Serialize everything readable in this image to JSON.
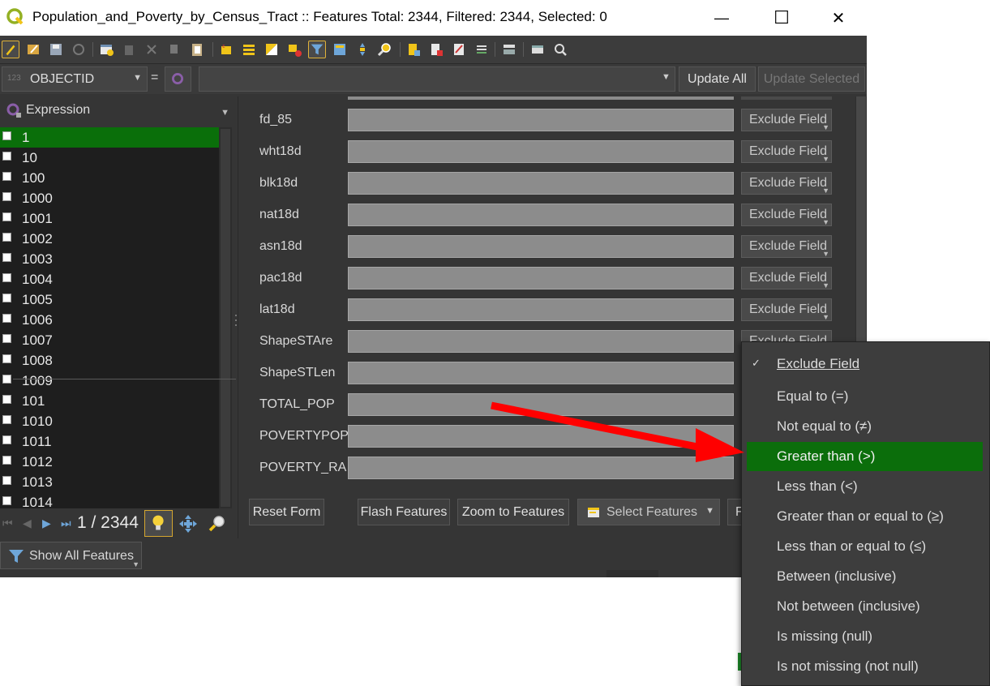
{
  "window": {
    "title": "Population_and_Poverty_by_Census_Tract :: Features Total: 2344, Filtered: 2344, Selected: 0",
    "minimize": "—",
    "maximize": "☐",
    "close": "✕"
  },
  "toolbar": {
    "icons": [
      "toggle-editing-icon",
      "multi-edit-icon",
      "save-edits-icon",
      "reload-icon",
      "add-feature-icon",
      "delete-feature-icon",
      "cut-icon",
      "copy-icon",
      "paste-icon",
      "select-by-expression-icon",
      "select-all-icon",
      "invert-selection-icon",
      "deselect-icon",
      "filter-icon",
      "move-selection-top-icon",
      "pan-to-selection-icon",
      "zoom-to-selection-icon",
      "new-field-icon",
      "delete-field-icon",
      "field-calculator-icon",
      "conditional-formatting-icon",
      "dock-icon",
      "actions-icon",
      "help-icon"
    ],
    "accent_color": "#e0b23a"
  },
  "exprbar": {
    "field_prefix": "123",
    "field": "OBJECTID",
    "equals": "=",
    "expression_value": "",
    "update_all": "Update All",
    "update_selected": "Update Selected"
  },
  "left": {
    "header": "Expression",
    "features": [
      "1",
      "10",
      "100",
      "1000",
      "1001",
      "1002",
      "1003",
      "1004",
      "1005",
      "1006",
      "1007",
      "1008",
      "1009",
      "101",
      "1010",
      "1011",
      "1012",
      "1013",
      "1014"
    ],
    "selected_index": 0,
    "selected_color": "#0a6f0a",
    "counter": "1 / 2344"
  },
  "form": {
    "fields": [
      "fd_85",
      "wht18d",
      "blk18d",
      "nat18d",
      "asn18d",
      "pac18d",
      "lat18d",
      "ShapeSTAre",
      "ShapeSTLen",
      "TOTAL_POP",
      "POVERTYPOP",
      "POVERTY_RA"
    ],
    "exclude_label": "Exclude Field",
    "buttons": {
      "reset": "Reset Form",
      "flash": "Flash Features",
      "zoom": "Zoom to Features",
      "select": "Select Features",
      "filter": "F"
    }
  },
  "show_all": "Show All Features",
  "menu": {
    "items": [
      {
        "label": "Exclude Field",
        "checked": true
      },
      {
        "label": "Equal to (=)"
      },
      {
        "label": "Not equal to (≠)"
      },
      {
        "label": "Greater than (>)",
        "highlighted": true
      },
      {
        "label": "Less than (<)"
      },
      {
        "label": "Greater than or equal to (≥)"
      },
      {
        "label": "Less than or equal to (≤)"
      },
      {
        "label": "Between (inclusive)"
      },
      {
        "label": "Not between (inclusive)"
      },
      {
        "label": "Is missing (null)"
      },
      {
        "label": "Is not missing (not null)"
      }
    ],
    "check_mark": "✓",
    "highlight_color": "#0b6e0b"
  },
  "annotation": {
    "arrow_color": "#ff0000"
  }
}
